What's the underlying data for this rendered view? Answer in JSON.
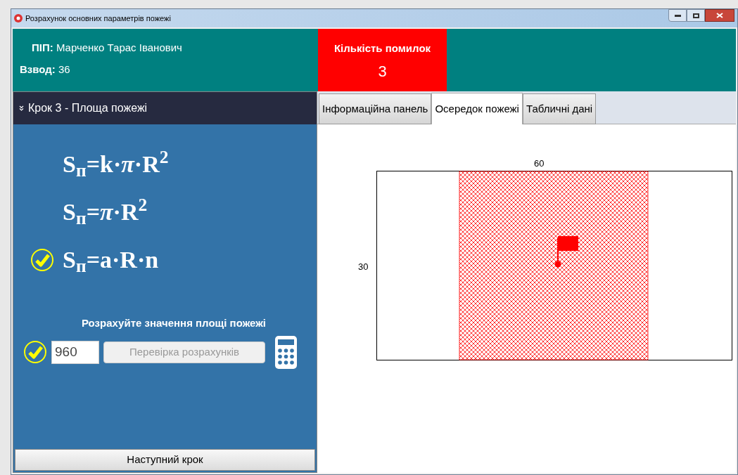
{
  "window": {
    "title": "Розрахунок основних параметрів пожежі"
  },
  "header": {
    "name_label": "ПІП:",
    "name": "Марченко Тарас Іванович",
    "platoon_label": "Взвод:",
    "platoon": "36",
    "errors": {
      "label": "Кількість помилок",
      "value": "3"
    }
  },
  "step": {
    "title": "Крок 3 - Площа пожежі",
    "formulas": [
      {
        "text": "S$_{п}$=k·*π*·R$^{2}$",
        "checked": false
      },
      {
        "text": "S$_{п}$=*π*·R$^{2}$",
        "checked": false
      },
      {
        "text": "S$_{п}$=a·R·n",
        "checked": true
      }
    ],
    "calc": {
      "prompt": "Розрахуйте значення площі пожежі",
      "checked": true,
      "value": "960",
      "button": "Перевірка розрахунків"
    },
    "next_button": "Наступний крок"
  },
  "tabs": [
    {
      "label": "Інформаційна панель",
      "selected": false
    },
    {
      "label": "Осередок пожежі",
      "selected": true
    },
    {
      "label": "Табличні дані",
      "selected": false
    }
  ],
  "diagram": {
    "top_label": "60",
    "side_label": "30"
  }
}
